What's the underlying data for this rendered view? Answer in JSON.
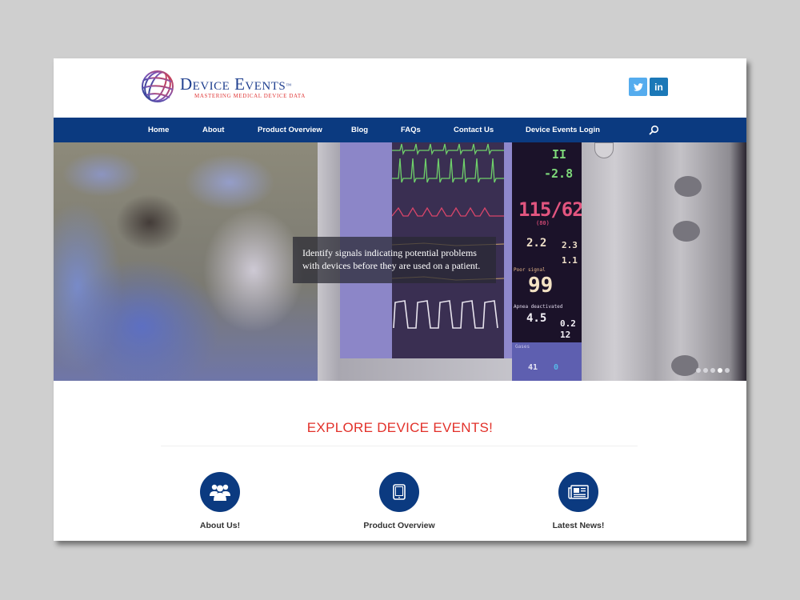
{
  "brand": {
    "title": "Device Events",
    "trademark": "™",
    "tagline": "Mastering Medical Device Data",
    "colors": {
      "primary": "#0b3a80",
      "accent": "#e2312a",
      "logo_blue": "#1f3f8f",
      "logo_red": "#e03a3a"
    }
  },
  "social": [
    {
      "name": "twitter",
      "glyph": "🐦",
      "color": "#55acee"
    },
    {
      "name": "linkedin",
      "glyph": "in",
      "color": "#1b78b7"
    }
  ],
  "nav": {
    "items": [
      {
        "label": "Home"
      },
      {
        "label": "About"
      },
      {
        "label": "Product Overview"
      },
      {
        "label": "Blog"
      },
      {
        "label": "FAQs"
      },
      {
        "label": "Contact Us"
      },
      {
        "label": "Device Events Login"
      }
    ],
    "search_icon": "search-icon"
  },
  "hero": {
    "caption_line1": "Identify signals indicating potential problems",
    "caption_line2": "with devices before they are used on a patient.",
    "slides_total": 5,
    "active_slide": 4,
    "monitor": {
      "lead": "II",
      "st": "-2.8",
      "bp": "115/62",
      "bp_mean": "(80)",
      "et": "2.2",
      "fi": "2.3",
      "mac": "1.1",
      "signal_note": "Poor signal",
      "spo2": "99",
      "apnea_note": "Apnea deactivated",
      "et2": "4.5",
      "fi2": "0.2",
      "rr": "12",
      "gases_label": "Gases",
      "o2": "41",
      "n2o": "0"
    }
  },
  "explore": {
    "title": "EXPLORE DEVICE EVENTS!",
    "features": [
      {
        "label": "About Us!",
        "icon": "users-icon"
      },
      {
        "label": "Product Overview",
        "icon": "tablet-icon"
      },
      {
        "label": "Latest News!",
        "icon": "newspaper-icon"
      }
    ]
  }
}
